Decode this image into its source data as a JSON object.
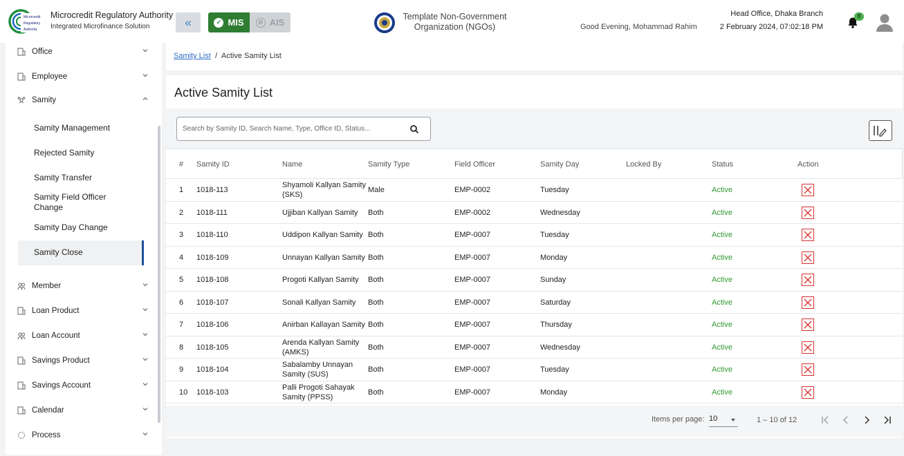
{
  "header": {
    "logo_text": [
      "Microcredit",
      "Regulatory",
      "Authority"
    ],
    "app_title": "Microcredit Regulatory Authority",
    "app_subtitle": "Integrated Microfinance Solution",
    "mis_label": "MIS",
    "ais_label": "AIS",
    "org_name": "Template Non-Government Organization (NGOs)",
    "greeting": "Good Evening, Mohammad Rahim",
    "branch": "Head Office, Dhaka Branch",
    "datetime": "2 February 2024, 07:02:18 PM",
    "notification_count": "8",
    "accent_color": "#2e7d32",
    "icons": [
      "double-chevron-left-icon",
      "check-circle-icon",
      "ban-icon",
      "bell-icon",
      "user-icon"
    ]
  },
  "sidebar": {
    "top_items": [
      {
        "label": "Office",
        "icon": "office-icon"
      },
      {
        "label": "Employee",
        "icon": "employee-icon"
      },
      {
        "label": "Samity",
        "icon": "samity-icon",
        "expanded": true
      }
    ],
    "samity_children": [
      {
        "label": "Samity Management"
      },
      {
        "label": "Rejected Samity"
      },
      {
        "label": "Samity Transfer"
      },
      {
        "label": "Samity Field Officer Change"
      },
      {
        "label": "Samity Day Change"
      },
      {
        "label": "Samity Close",
        "active": true
      }
    ],
    "bottom_items": [
      {
        "label": "Member",
        "icon": "member-icon"
      },
      {
        "label": "Loan Product",
        "icon": "loan-product-icon"
      },
      {
        "label": "Loan Account",
        "icon": "loan-account-icon"
      },
      {
        "label": "Savings Product",
        "icon": "savings-product-icon"
      },
      {
        "label": "Savings Account",
        "icon": "savings-account-icon"
      },
      {
        "label": "Calendar",
        "icon": "calendar-icon"
      },
      {
        "label": "Process",
        "icon": "process-icon"
      }
    ]
  },
  "breadcrumb": {
    "link": "Samity List",
    "separator": "/",
    "current": "Active Samity List"
  },
  "main": {
    "title": "Active Samity List",
    "search_placeholder": "Search by Samity ID, Search Name, Type, Office ID, Status...",
    "columns": [
      "#",
      "Samity ID",
      "Name",
      "Samity Type",
      "Field Officer",
      "Samity Day",
      "Locked By",
      "Status",
      "Action"
    ],
    "rows": [
      {
        "no": "1",
        "id": "1018-113",
        "name": "Shyamoli Kallyan Samity (SKS)",
        "type": "Male",
        "officer": "EMP-0002",
        "day": "Tuesday",
        "locked": "",
        "status": "Active"
      },
      {
        "no": "2",
        "id": "1018-111",
        "name": "Ujjiban Kallyan Samity",
        "type": "Both",
        "officer": "EMP-0002",
        "day": "Wednesday",
        "locked": "",
        "status": "Active"
      },
      {
        "no": "3",
        "id": "1018-110",
        "name": "Uddipon Kallyan Samity",
        "type": "Both",
        "officer": "EMP-0007",
        "day": "Tuesday",
        "locked": "",
        "status": "Active"
      },
      {
        "no": "4",
        "id": "1018-109",
        "name": "Unnayan Kallyan Samity",
        "type": "Both",
        "officer": "EMP-0007",
        "day": "Monday",
        "locked": "",
        "status": "Active"
      },
      {
        "no": "5",
        "id": "1018-108",
        "name": "Progoti Kallyan Samity",
        "type": "Both",
        "officer": "EMP-0007",
        "day": "Sunday",
        "locked": "",
        "status": "Active"
      },
      {
        "no": "6",
        "id": "1018-107",
        "name": "Sonali Kallyan Samity",
        "type": "Both",
        "officer": "EMP-0007",
        "day": "Saturday",
        "locked": "",
        "status": "Active"
      },
      {
        "no": "7",
        "id": "1018-106",
        "name": "Anirban Kallayan Samity",
        "type": "Both",
        "officer": "EMP-0007",
        "day": "Thursday",
        "locked": "",
        "status": "Active"
      },
      {
        "no": "8",
        "id": "1018-105",
        "name": "Arenda Kallyan Samity (AMKS)",
        "type": "Both",
        "officer": "EMP-0007",
        "day": "Wednesday",
        "locked": "",
        "status": "Active"
      },
      {
        "no": "9",
        "id": "1018-104",
        "name": "Sabalamby Unnayan Samity (SUS)",
        "type": "Both",
        "officer": "EMP-0007",
        "day": "Tuesday",
        "locked": "",
        "status": "Active"
      },
      {
        "no": "10",
        "id": "1018-103",
        "name": "Palli Progoti Sahayak Samity (PPSS)",
        "type": "Both",
        "officer": "EMP-0007",
        "day": "Monday",
        "locked": "",
        "status": "Active"
      }
    ],
    "status_color": "#2e9a2e",
    "delete_color": "#d9312d"
  },
  "pagination": {
    "items_label": "Items per page:",
    "page_size": "10",
    "range": "1 – 10 of 12"
  }
}
